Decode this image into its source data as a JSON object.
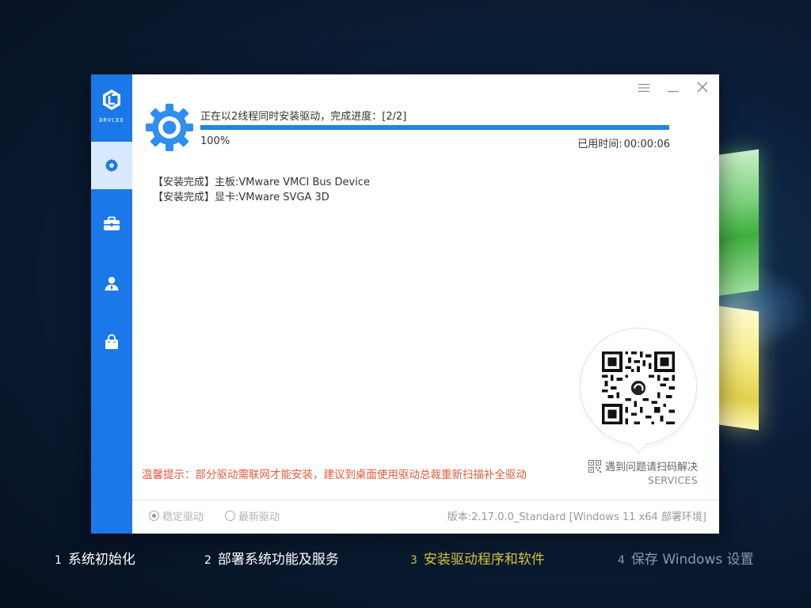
{
  "app": {
    "brand_name": "DRVCEO"
  },
  "window_controls": {
    "menu_icon": "menu-icon",
    "minimize_icon": "minimize-icon",
    "close_icon": "close-icon"
  },
  "sidebar": {
    "items": [
      {
        "name": "driver-install",
        "icon": "gear-icon",
        "active": true
      },
      {
        "name": "toolbox",
        "icon": "toolbox-icon",
        "active": false
      },
      {
        "name": "user",
        "icon": "user-icon",
        "active": false
      },
      {
        "name": "software",
        "icon": "bag-icon",
        "active": false
      }
    ]
  },
  "progress": {
    "status": "正在以2线程同时安装驱动，完成进度：[2/2]",
    "percent_label": "100%",
    "percent": 100,
    "elapsed_label": "已用时间:",
    "elapsed_value": "00:00:06"
  },
  "log": [
    {
      "tag": "【安装完成】",
      "text": "主板:VMware VMCI Bus Device"
    },
    {
      "tag": "【安装完成】",
      "text": "显卡:VMware SVGA 3D"
    }
  ],
  "tip": "温馨提示：部分驱动需联网才能安装，建议到桌面使用驱动总裁重新扫描补全驱动",
  "help": {
    "label": "遇到问题请扫码解决",
    "sub": "SERVICES"
  },
  "footer": {
    "option_stable": "稳定驱动",
    "option_latest": "最新驱动",
    "selected": "稳定驱动",
    "version": "版本:2.17.0.0_Standard [Windows 11 x64 部署环境]"
  },
  "steps": [
    {
      "num": "1",
      "label": "系统初始化",
      "state": "done"
    },
    {
      "num": "2",
      "label": "部署系统功能及服务",
      "state": "done"
    },
    {
      "num": "3",
      "label": "安装驱动程序和软件",
      "state": "current"
    },
    {
      "num": "4",
      "label": "保存 Windows 设置",
      "state": "pending"
    }
  ],
  "colors": {
    "sidebar": "#1a78e8",
    "progress": "#1b87ea",
    "tip": "#e25a3c",
    "current_step": "#d6c23a"
  }
}
